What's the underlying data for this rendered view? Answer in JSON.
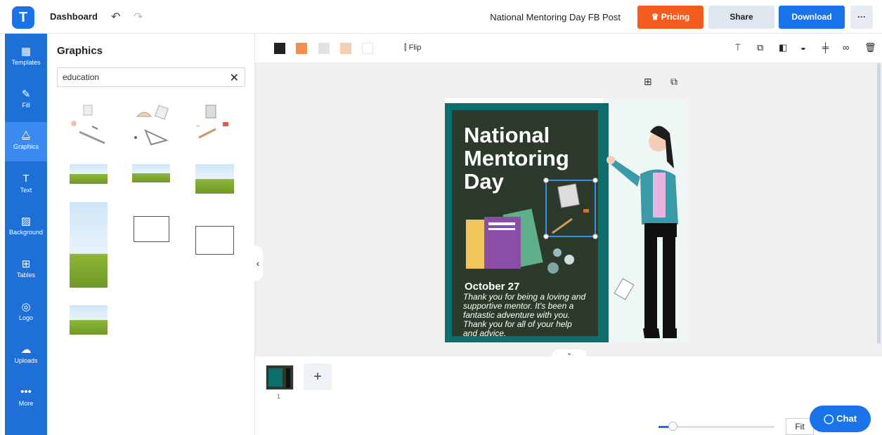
{
  "topbar": {
    "logo_letter": "T",
    "dashboard_label": "Dashboard",
    "undo_icon": "undo-icon",
    "redo_icon": "redo-icon",
    "doc_title": "National Mentoring Day FB Post",
    "pricing_label": "Pricing",
    "share_label": "Share",
    "download_label": "Download",
    "more_label": "···"
  },
  "rail": {
    "items": [
      {
        "label": "Templates",
        "icon": "templates-icon"
      },
      {
        "label": "Fill",
        "icon": "fill-icon"
      },
      {
        "label": "Graphics",
        "icon": "graphics-icon"
      },
      {
        "label": "Text",
        "icon": "text-icon"
      },
      {
        "label": "Background",
        "icon": "background-icon"
      },
      {
        "label": "Tables",
        "icon": "tables-icon"
      },
      {
        "label": "Logo",
        "icon": "logo-icon"
      },
      {
        "label": "Uploads",
        "icon": "uploads-icon"
      },
      {
        "label": "More",
        "icon": "more-icon"
      }
    ]
  },
  "panel": {
    "title": "Graphics",
    "search_value": "education"
  },
  "canvas_toolbar": {
    "swatches": [
      "#222222",
      "#f0904a",
      "#dfe3e6",
      "#f5cfae",
      "#ffffff"
    ],
    "flip_label": "Flip"
  },
  "design": {
    "headline_line1": "National",
    "headline_line2": "Mentoring",
    "headline_line3": "Day",
    "date": "October 27",
    "message": "Thank you for being a loving and supportive mentor. It's been a fantastic adventure with you. Thank you for all of your help and advice."
  },
  "pages": {
    "page_number": "1",
    "add_label": "+"
  },
  "bottom": {
    "fit_label": "Fit",
    "chat_label": "Chat"
  }
}
